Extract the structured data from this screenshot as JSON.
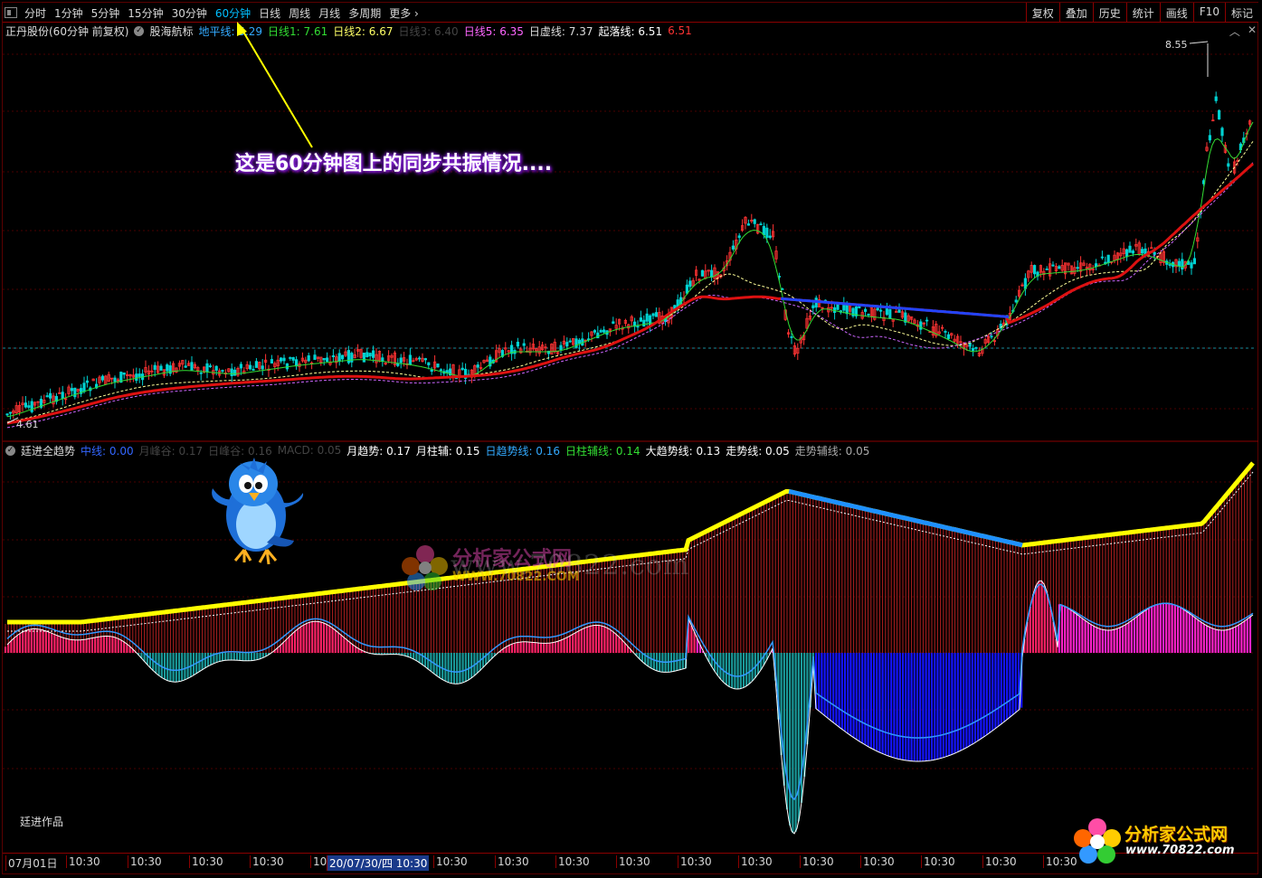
{
  "toolbar": {
    "periods": [
      "分时",
      "1分钟",
      "5分钟",
      "15分钟",
      "30分钟",
      "60分钟",
      "日线",
      "周线",
      "月线",
      "多周期",
      "更多 ›"
    ],
    "active_period": "60分钟",
    "right_buttons": [
      "复权",
      "叠加",
      "历史",
      "统计",
      "画线",
      "F10",
      "标记"
    ]
  },
  "infobar": {
    "stock": "正丹股份(60分钟 前复权)",
    "indicator": "股海航标",
    "items": [
      {
        "label": "地平线:",
        "value": "5.29",
        "color": "#33aaff"
      },
      {
        "label": "日线1:",
        "value": "7.61",
        "color": "#33dd33"
      },
      {
        "label": "日线2:",
        "value": "6.67",
        "color": "#ffff66"
      },
      {
        "label": "日线3:",
        "value": "6.40",
        "color": "#444444"
      },
      {
        "label": "日线5:",
        "value": "6.35",
        "color": "#ff66ff"
      },
      {
        "label": "日虚线:",
        "value": "7.37",
        "color": "#dddddd"
      },
      {
        "label": "起落线:",
        "value": "6.51",
        "color": "#ffffff"
      },
      {
        "label": "",
        "value": "6.51",
        "color": "#ff3333"
      }
    ]
  },
  "price_labels": {
    "high": "8.55",
    "low": "4.61"
  },
  "annotation": "这是60分钟图上的同步共振情况....",
  "indicator_bar": {
    "name": "廷进全趋势",
    "items": [
      {
        "label": "中线:",
        "value": "0.00",
        "color": "#3366ff"
      },
      {
        "label": "月峰谷:",
        "value": "0.17",
        "color": "#444444"
      },
      {
        "label": "日峰谷:",
        "value": "0.16",
        "color": "#444444"
      },
      {
        "label": "MACD:",
        "value": "0.05",
        "color": "#444444"
      },
      {
        "label": "月趋势:",
        "value": "0.17",
        "color": "#ffffff"
      },
      {
        "label": "月柱辅:",
        "value": "0.15",
        "color": "#ffffff"
      },
      {
        "label": "日趋势线:",
        "value": "0.16",
        "color": "#33aaff"
      },
      {
        "label": "日柱辅线:",
        "value": "0.14",
        "color": "#33dd33"
      },
      {
        "label": "大趋势线:",
        "value": "0.13",
        "color": "#ffffff"
      },
      {
        "label": "走势线:",
        "value": "0.05",
        "color": "#ffffff"
      },
      {
        "label": "走势辅线:",
        "value": "0.05",
        "color": "#aaaaaa"
      }
    ]
  },
  "watermark": {
    "site": "www.70822.com",
    "brand": "分析家公式网",
    "url": "WWW.70822.COM"
  },
  "credit": "廷进作品",
  "time_axis": [
    "07月01日",
    "10:30",
    "10:30",
    "10:30",
    "10:30",
    "10:30",
    "20/07/30/四 10:30",
    "10:30",
    "10:30",
    "10:30",
    "10:30",
    "10:30",
    "10:30",
    "10:30",
    "10:30",
    "10:30",
    "10:30",
    "10:30"
  ],
  "logo": {
    "text": "分析家公式网",
    "url": "www.70822.com"
  }
}
